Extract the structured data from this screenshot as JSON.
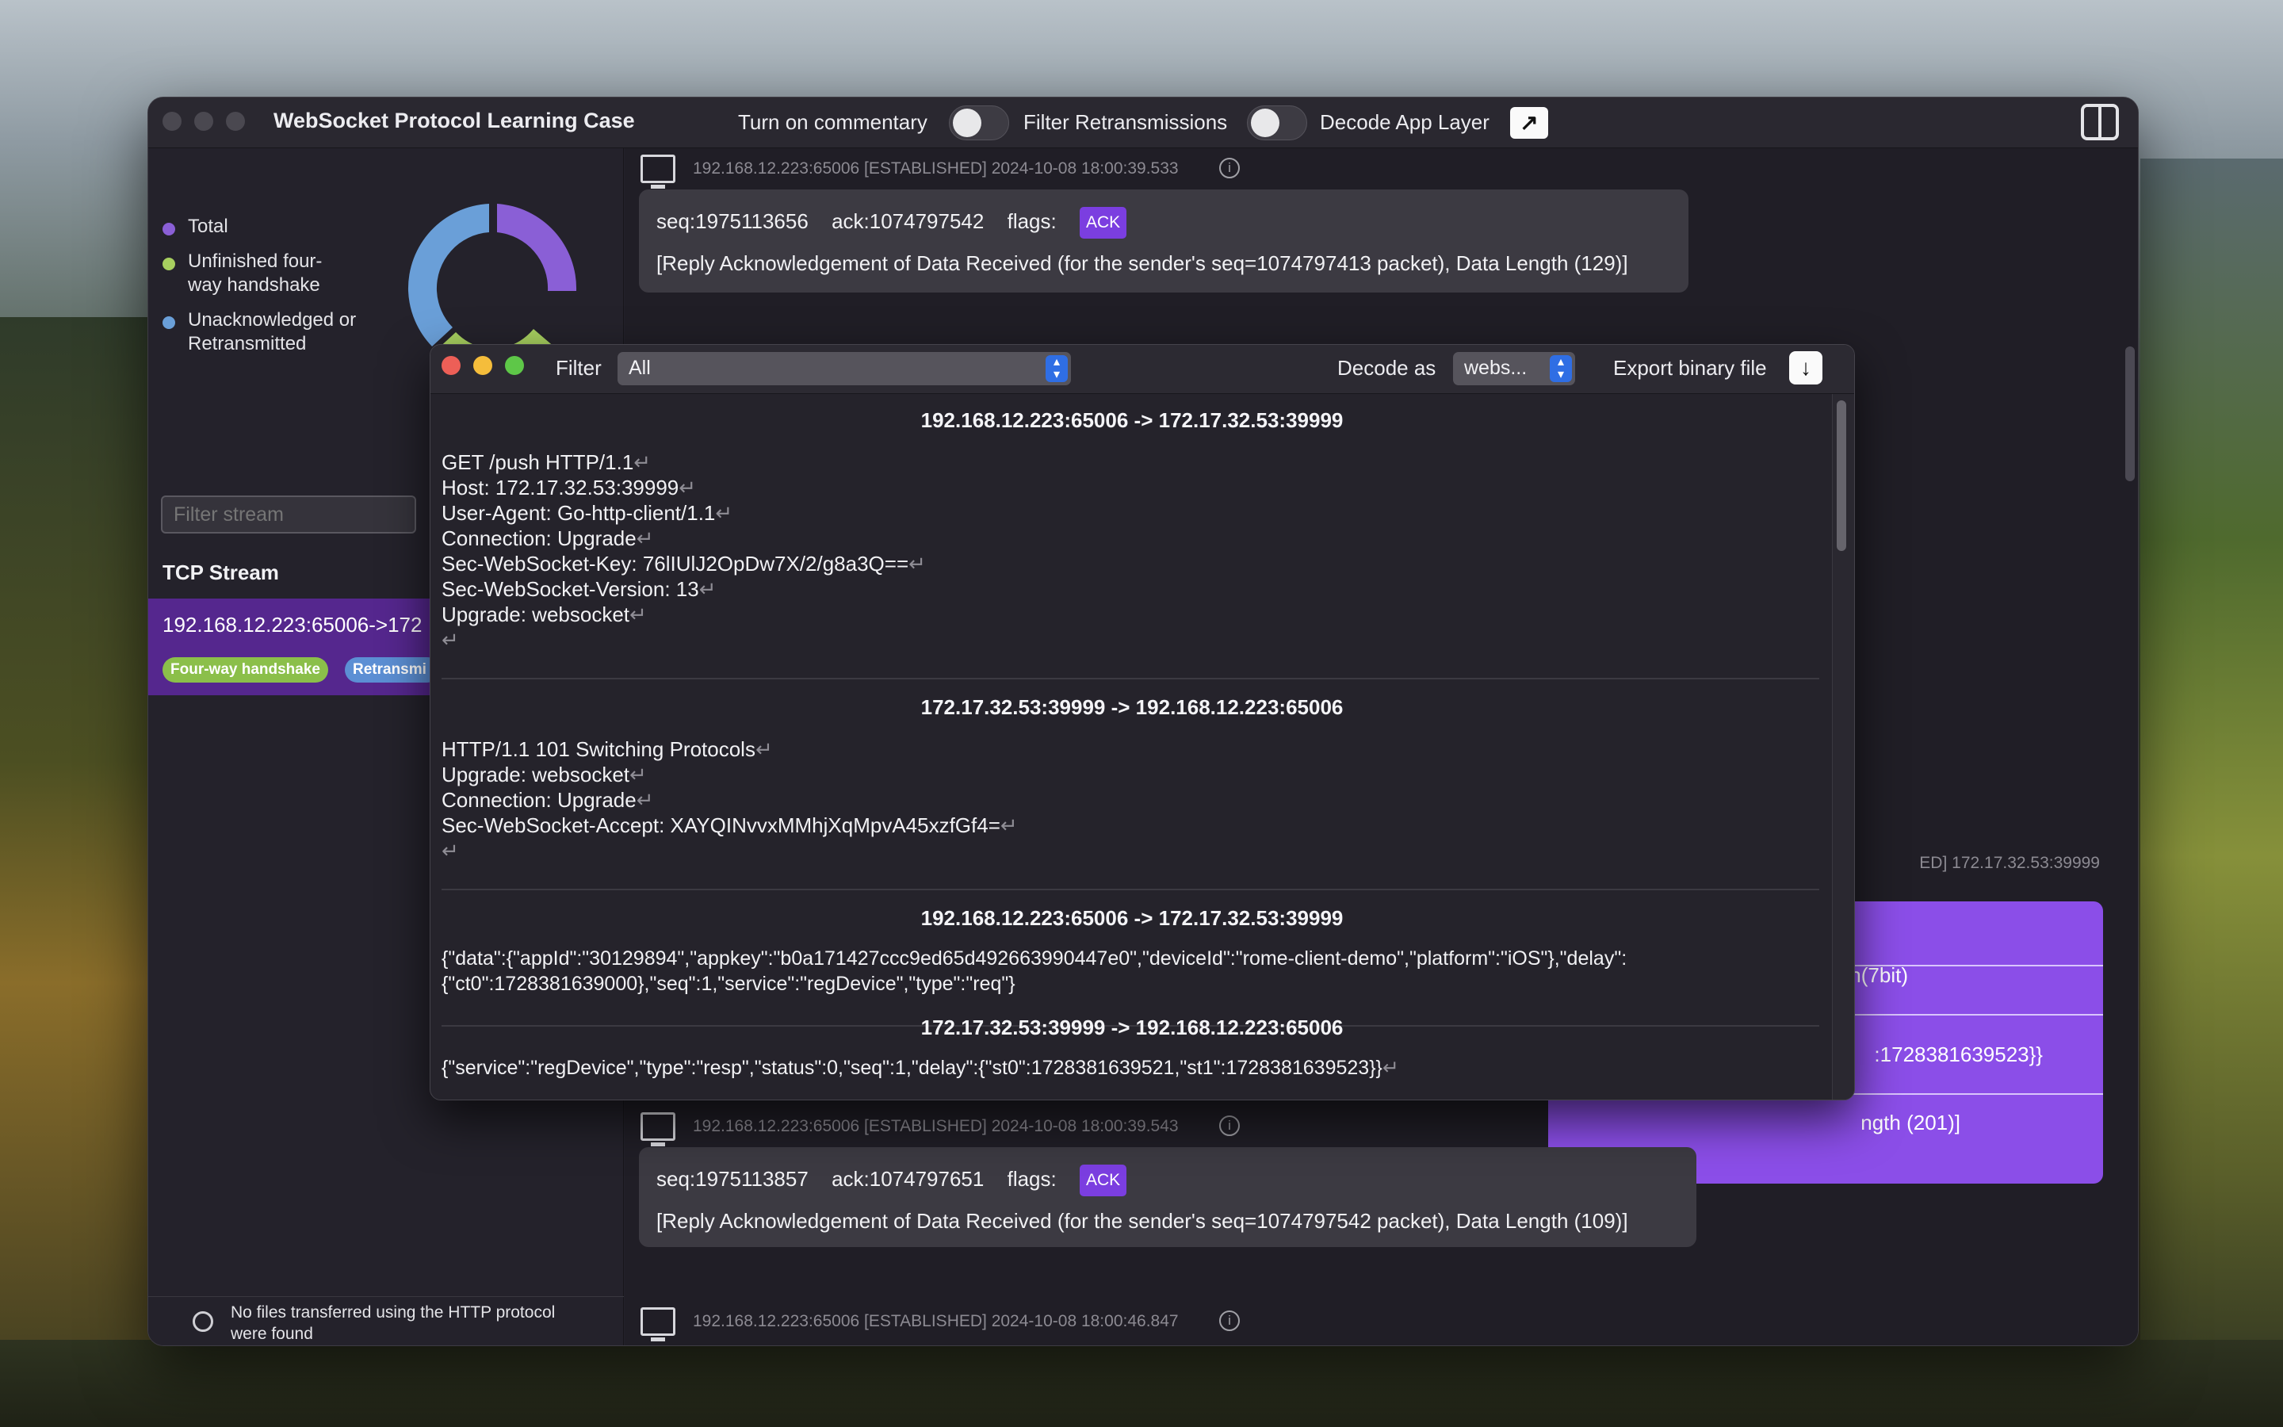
{
  "window": {
    "title": "WebSocket Protocol Learning Case",
    "toggles": [
      {
        "label": "Turn on commentary",
        "on": false
      },
      {
        "label": "Filter Retransmissions",
        "on": false
      }
    ],
    "decode_app_layer_label": "Decode App Layer"
  },
  "sidebar": {
    "legend": [
      {
        "label": "Total",
        "color": "#8a5fd6"
      },
      {
        "label": "Unfinished four-way handshake",
        "color": "#a7cf5f"
      },
      {
        "label": "Unacknowledged or Retransmitted",
        "color": "#6a9fd8"
      }
    ],
    "filter_placeholder": "Filter stream",
    "section_title": "TCP Stream",
    "stream": {
      "name": "192.168.12.223:65006->172",
      "chips": [
        {
          "label": "Four-way handshake",
          "color": "#8bbf4a"
        },
        {
          "label": "Retransmi",
          "color": "#5c8fd4"
        }
      ]
    },
    "footer_message": "No files transferred using the HTTP protocol were found"
  },
  "packets": [
    {
      "meta": "192.168.12.223:65006   [ESTABLISHED]   2024-10-08 18:00:39.533",
      "seq": "seq:1975113656",
      "ack": "ack:1074797542",
      "flags_label": "flags:",
      "flag": "ACK",
      "summary": "[Reply Acknowledgement of Data Received (for the sender's seq=1074797413 packet), Data Length (129)]"
    },
    {
      "meta": "192.168.12.223:65006   [ESTABLISHED]   2024-10-08 18:00:39.543",
      "seq": "seq:1975113857",
      "ack": "ack:1074797651",
      "flags_label": "flags:",
      "flag": "ACK",
      "summary": "[Reply Acknowledgement of Data Received (for the sender's seq=1074797542 packet), Data Length (109)]"
    },
    {
      "meta": "192.168.12.223:65006   [ESTABLISHED]   2024-10-08 18:00:46.847"
    }
  ],
  "right_packet": {
    "meta": "ED]   172.17.32.53:39999",
    "lines": [
      "n(7bit)",
      ":1728381639523}}",
      "ngth (201)]"
    ]
  },
  "popup": {
    "filter_label": "Filter",
    "filter_value": "All",
    "decode_label": "Decode as",
    "decode_value": "webs...",
    "export_label": "Export binary file",
    "sections": [
      {
        "title": "192.168.12.223:65006 -> 172.17.32.53:39999",
        "lines": [
          "GET /push HTTP/1.1",
          "Host: 172.17.32.53:39999",
          "User-Agent: Go-http-client/1.1",
          "Connection: Upgrade",
          "Sec-WebSocket-Key: 76lIUlJ2OpDw7X/2/g8a3Q==",
          "Sec-WebSocket-Version: 13",
          "Upgrade: websocket",
          ""
        ]
      },
      {
        "title": "172.17.32.53:39999 -> 192.168.12.223:65006",
        "lines": [
          "HTTP/1.1 101 Switching Protocols",
          "Upgrade: websocket",
          "Connection: Upgrade",
          "Sec-WebSocket-Accept: XAYQINvvxMMhjXqMpvA45xzfGf4=",
          ""
        ]
      },
      {
        "title": "192.168.12.223:65006 -> 172.17.32.53:39999",
        "lines": [
          "{\"data\":{\"appId\":\"30129894\",\"appkey\":\"b0a171427ccc9ed65d492663990447e0\",\"deviceId\":\"rome-client-demo\",\"platform\":\"iOS\"},\"delay\":",
          "{\"ct0\":1728381639000},\"seq\":1,\"service\":\"regDevice\",\"type\":\"req\"}"
        ]
      },
      {
        "title": "172.17.32.53:39999 -> 192.168.12.223:65006",
        "lines": [
          "{\"service\":\"regDevice\",\"type\":\"resp\",\"status\":0,\"seq\":1,\"delay\":{\"st0\":1728381639521,\"st1\":1728381639523}}"
        ]
      }
    ]
  },
  "colors": {
    "accent_purple": "#7b3ee0",
    "selected_stream": "#55278e",
    "stepper_blue": "#2f6ee4"
  }
}
